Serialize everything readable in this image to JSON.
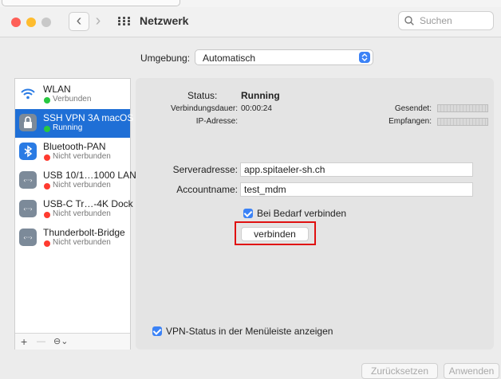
{
  "window": {
    "title": "Netzwerk"
  },
  "search": {
    "placeholder": "Suchen"
  },
  "colors": {
    "close": "#fe5f57",
    "minimize": "#febc2e",
    "zoom": "#c8c8c8",
    "accent": "#1f6fd6",
    "connected": "#28c840",
    "disconnected": "#ff3b30"
  },
  "location": {
    "label": "Umgebung:",
    "value": "Automatisch"
  },
  "services": [
    {
      "name": "WLAN",
      "status": "Verbunden",
      "state": "connected",
      "icon": "wifi-icon"
    },
    {
      "name": "SSH VPN 3A macOS",
      "status": "Running",
      "state": "connected",
      "icon": "lock-icon",
      "selected": true
    },
    {
      "name": "Bluetooth-PAN",
      "status": "Nicht verbunden",
      "state": "disconnected",
      "icon": "bluetooth-icon"
    },
    {
      "name": "USB 10/1…1000 LAN",
      "status": "Nicht verbunden",
      "state": "disconnected",
      "icon": "ethernet-icon"
    },
    {
      "name": "USB-C Tr…-4K Dock",
      "status": "Nicht verbunden",
      "state": "disconnected",
      "icon": "ethernet-icon"
    },
    {
      "name": "Thunderbolt-Bridge",
      "status": "Nicht verbunden",
      "state": "disconnected",
      "icon": "ethernet-icon"
    }
  ],
  "sidebar_controls": {
    "add": "+",
    "remove": "—",
    "more": "⊖⌄"
  },
  "detail": {
    "status_label": "Status:",
    "status_value": "Running",
    "duration_label": "Verbindungsdauer:",
    "duration_value": "00:00:24",
    "ip_label": "IP-Adresse:",
    "sent_label": "Gesendet:",
    "received_label": "Empfangen:",
    "server_label": "Serveradresse:",
    "server_value": "app.spitaeler-sh.ch",
    "account_label": "Accountname:",
    "account_value": "test_mdm",
    "on_demand_label": "Bei Bedarf verbinden",
    "connect_button": "verbinden",
    "menu_status_label": "VPN-Status in der Menüleiste anzeigen"
  },
  "footer": {
    "reset": "Zurücksetzen",
    "apply": "Anwenden"
  }
}
